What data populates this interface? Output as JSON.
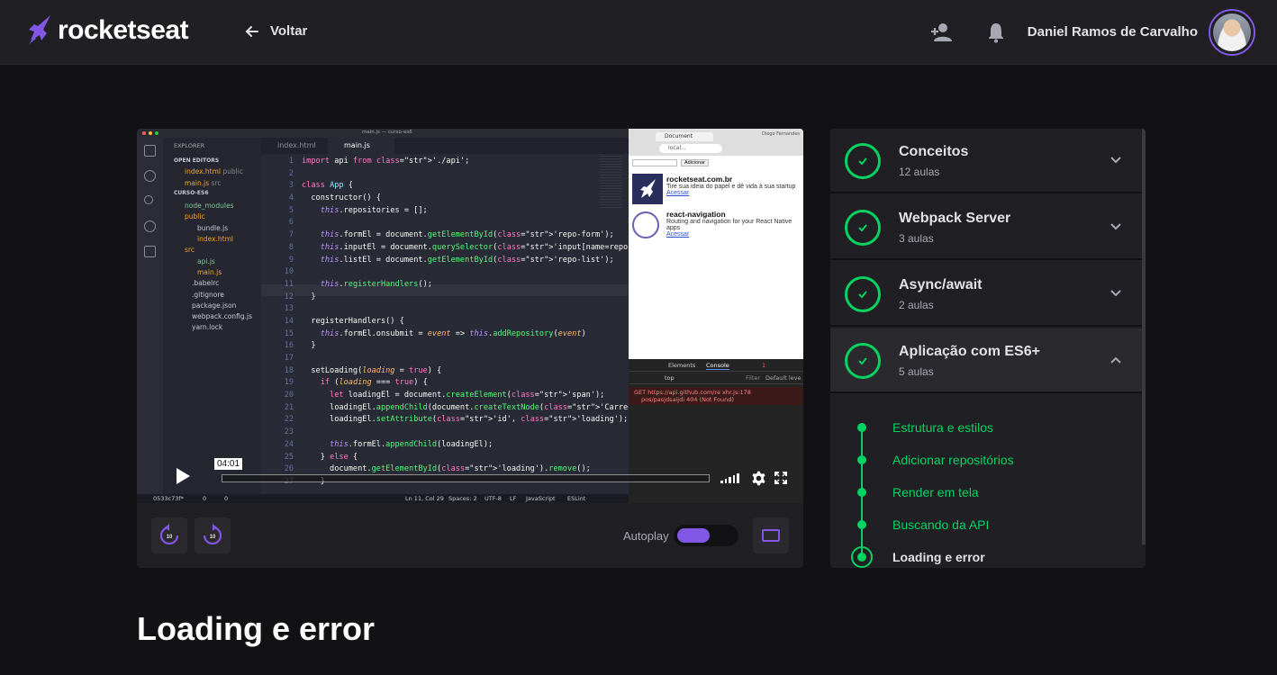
{
  "header": {
    "brand": "rocketseat",
    "back_label": "Voltar",
    "user_name": "Daniel Ramos de Carvalho",
    "icons": [
      "add-user-icon",
      "bell-icon"
    ]
  },
  "player": {
    "time_tooltip": "04:01",
    "autoplay_label": "Autoplay",
    "autoplay_on": true,
    "skip_back_label": "10",
    "skip_forward_label": "10",
    "accent_color": "#8257e5"
  },
  "video_frame": {
    "window_title": "main.js — curso-es6",
    "explorer": {
      "header": "EXPLORER",
      "open_editors": "OPEN EDITORS",
      "open_files": [
        {
          "name": "index.html",
          "path": "public",
          "badge": "M"
        },
        {
          "name": "main.js",
          "path": "src",
          "badge": "M"
        }
      ],
      "project": "CURSO-ES6",
      "tree": [
        "node_modules",
        "public",
        "bundle.js",
        "index.html",
        "src",
        "api.js",
        "main.js",
        ".babelrc",
        ".gitignore",
        "package.json",
        "webpack.config.js",
        "yarn.lock"
      ]
    },
    "tabs": [
      "index.html",
      "main.js"
    ],
    "code_lines": [
      "import api from './api';",
      "",
      "class App {",
      "  constructor() {",
      "    this.repositories = [];",
      "",
      "    this.formEl = document.getElementById('repo-form');",
      "    this.inputEl = document.querySelector('input[name=reposit",
      "    this.listEl = document.getElementById('repo-list');",
      "",
      "    this.registerHandlers();",
      "  }",
      "",
      "  registerHandlers() {",
      "    this.formEl.onsubmit = event => this.addRepository(event)",
      "  }",
      "",
      "  setLoading(loading = true) {",
      "    if (loading === true) {",
      "      let loadingEl = document.createElement('span');",
      "      loadingEl.appendChild(document.createTextNode('Carregan",
      "      loadingEl.setAttribute('id', 'loading');",
      "",
      "      this.formEl.appendChild(loadingEl);",
      "    } else {",
      "      document.getElementById('loading').remove();",
      "    }"
    ],
    "status": {
      "branch": "0533c73f*",
      "errors": "0",
      "warnings": "0",
      "position": "Ln 11, Col 29",
      "spaces": "Spaces: 2",
      "encoding": "UTF-8",
      "eol": "LF",
      "language": "JavaScript",
      "linter": "ESLint"
    },
    "browser": {
      "user": "Diego Fernandes",
      "tab_title": "Document",
      "url": "local...",
      "button": "Adicionar",
      "repos": [
        {
          "title": "rocketseat.com.br",
          "desc": "Tire sua ideia do papel e dê vida à sua startup",
          "link": "Acessar"
        },
        {
          "title": "react-navigation",
          "desc": "Routing and navigation for your React Native apps",
          "link": "Acessar"
        }
      ]
    },
    "devtools": {
      "tabs": [
        "Elements",
        "Console"
      ],
      "error_count": "1",
      "context": "top",
      "filter": "Filter",
      "levels": "Default leve",
      "error_line_1": "GET https://api.github.com/re xhr.js:178",
      "error_line_2": "pos/pasjdsaijdi 404 (Not Found)"
    }
  },
  "modules": [
    {
      "title": "Conceitos",
      "count": "12 aulas",
      "open": false
    },
    {
      "title": "Webpack Server",
      "count": "3 aulas",
      "open": false
    },
    {
      "title": "Async/await",
      "count": "2 aulas",
      "open": false
    },
    {
      "title": "Aplicação com ES6+",
      "count": "5 aulas",
      "open": true
    }
  ],
  "lessons": [
    {
      "title": "Estrutura e estilos",
      "current": false
    },
    {
      "title": "Adicionar repositórios",
      "current": false
    },
    {
      "title": "Render em tela",
      "current": false
    },
    {
      "title": "Buscando da API",
      "current": false
    },
    {
      "title": "Loading e error",
      "current": true
    }
  ],
  "lesson_title": "Loading e error",
  "colors": {
    "success": "#04d361",
    "brand": "#8257e5",
    "background": "#121214",
    "surface": "#202024"
  }
}
